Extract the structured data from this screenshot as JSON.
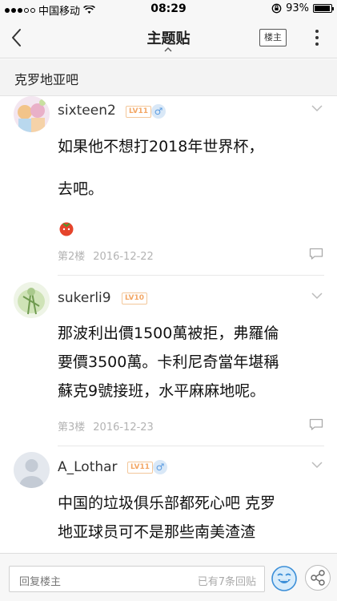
{
  "status_bar": {
    "carrier": "中国移动",
    "time": "08:29",
    "battery": "93%",
    "battery_level": 0.93
  },
  "nav": {
    "title": "主题贴",
    "owner_button": "楼主"
  },
  "forum": {
    "name": "克罗地亚吧"
  },
  "posts": [
    {
      "username": "sixteen2",
      "level": "LV11",
      "gender": "♂",
      "lines": [
        "如果他不想打2018年世界杯，",
        "去吧。"
      ],
      "floor": "第2楼",
      "date": "2016-12-22"
    },
    {
      "username": "sukerli9",
      "level": "LV10",
      "lines": [
        "那波利出價1500萬被拒，弗羅倫",
        "要價3500萬。卡利尼奇當年堪稱",
        "蘇克9號接班，水平麻麻地呢。"
      ],
      "floor": "第3楼",
      "date": "2016-12-23"
    },
    {
      "username": "A_Lothar",
      "level": "LV11",
      "gender": "♂",
      "lines": [
        "中国的垃圾俱乐部都死心吧 克罗",
        "地亚球员可不是那些南美渣渣"
      ]
    }
  ],
  "bottom_bar": {
    "reply_placeholder": "回复楼主",
    "reply_count": "已有7条回贴"
  },
  "icons": {
    "back": "back-arrow-icon",
    "more": "more-vertical-icon",
    "wifi": "wifi-icon",
    "lock": "rotation-lock-icon",
    "reply": "reply-bubble-icon",
    "share": "share-icon",
    "emoji": "emoji-icon"
  }
}
